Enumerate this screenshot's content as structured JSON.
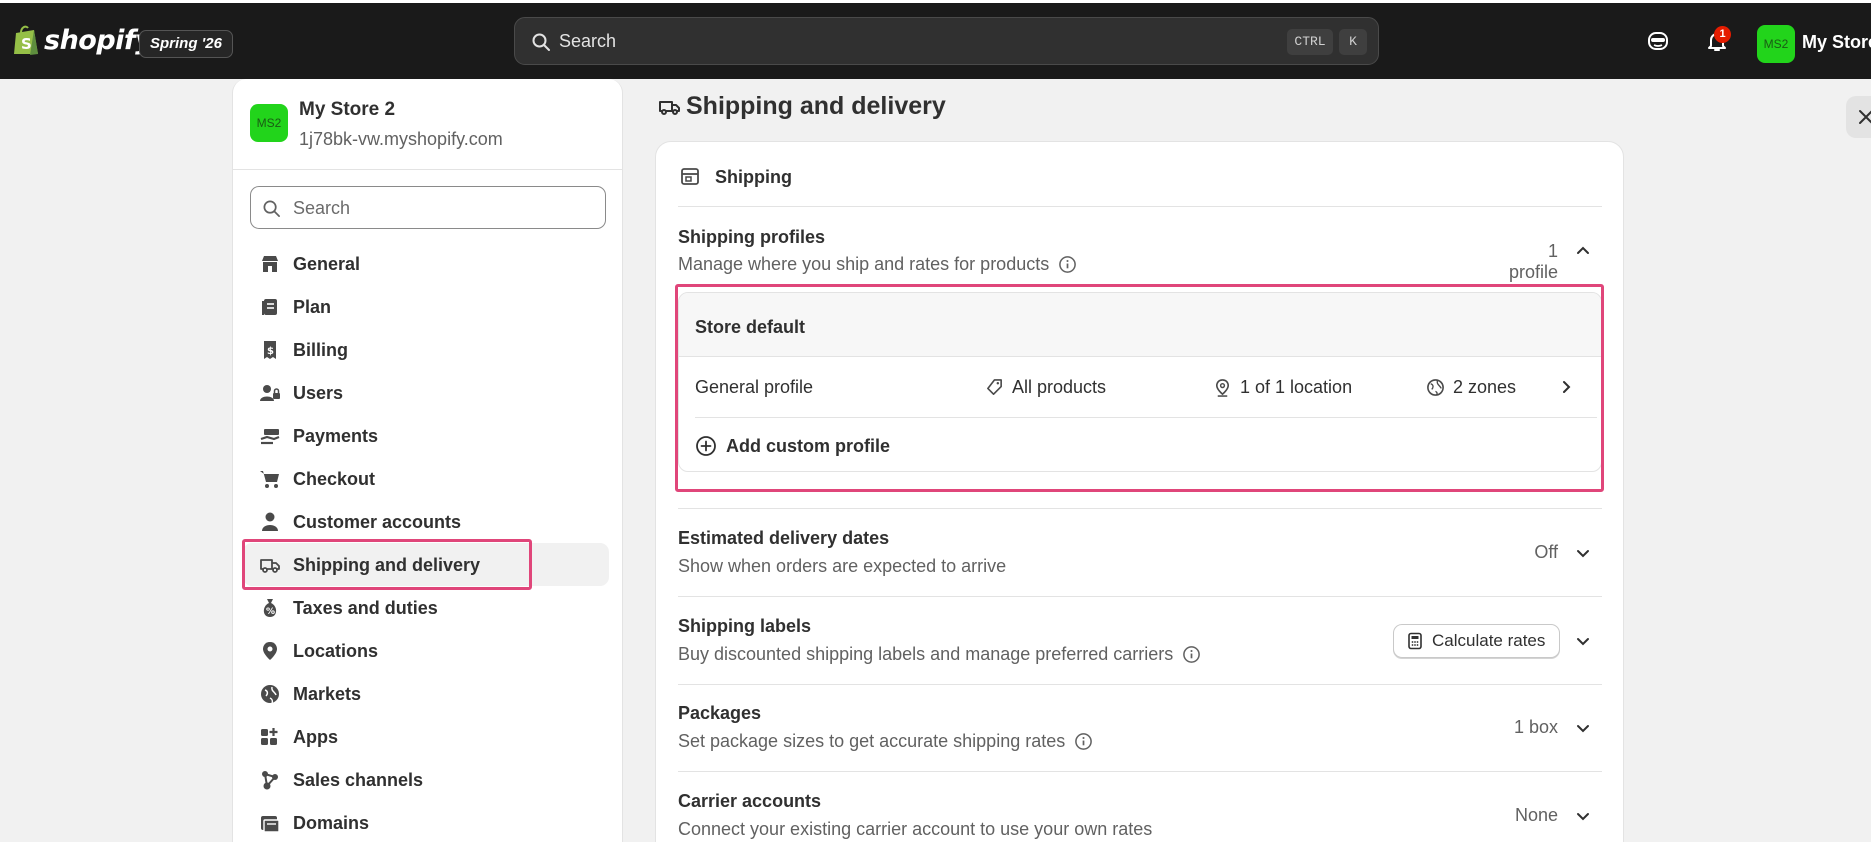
{
  "topbar": {
    "brand": "shopify",
    "edition": "Spring '26",
    "search_placeholder": "Search",
    "shortcut_ctrl": "CTRL",
    "shortcut_k": "K",
    "notification_count": "1",
    "avatar_initials": "MS2",
    "store_name": "My Store"
  },
  "sidebar": {
    "avatar_initials": "MS2",
    "store_name": "My Store 2",
    "store_domain": "1j78bk-vw.myshopify.com",
    "search_placeholder": "Search",
    "items": [
      {
        "label": "General",
        "icon": "store-icon"
      },
      {
        "label": "Plan",
        "icon": "plan-icon"
      },
      {
        "label": "Billing",
        "icon": "billing-icon"
      },
      {
        "label": "Users",
        "icon": "users-icon"
      },
      {
        "label": "Payments",
        "icon": "payments-icon"
      },
      {
        "label": "Checkout",
        "icon": "cart-icon"
      },
      {
        "label": "Customer accounts",
        "icon": "person-icon"
      },
      {
        "label": "Shipping and delivery",
        "icon": "truck-icon",
        "active": true
      },
      {
        "label": "Taxes and duties",
        "icon": "tax-icon"
      },
      {
        "label": "Locations",
        "icon": "location-icon"
      },
      {
        "label": "Markets",
        "icon": "globe-icon"
      },
      {
        "label": "Apps",
        "icon": "apps-icon"
      },
      {
        "label": "Sales channels",
        "icon": "channels-icon"
      },
      {
        "label": "Domains",
        "icon": "domains-icon"
      }
    ]
  },
  "main": {
    "page_title": "Shipping and delivery",
    "card_title": "Shipping",
    "profiles": {
      "title": "Shipping profiles",
      "description": "Manage where you ship and rates for products",
      "count": "1 profile",
      "group_title": "Store default",
      "row": {
        "name": "General profile",
        "products": "All products",
        "locations": "1 of 1 location",
        "zones": "2 zones"
      },
      "add_label": "Add custom profile"
    },
    "delivery_dates": {
      "title": "Estimated delivery dates",
      "description": "Show when orders are expected to arrive",
      "status": "Off"
    },
    "labels": {
      "title": "Shipping labels",
      "description": "Buy discounted shipping labels and manage preferred carriers",
      "button": "Calculate rates"
    },
    "packages": {
      "title": "Packages",
      "description": "Set package sizes to get accurate shipping rates",
      "status": "1 box"
    },
    "carriers": {
      "title": "Carrier accounts",
      "description": "Connect your existing carrier account to use your own rates",
      "status": "None"
    }
  },
  "colors": {
    "topbar": "#1a1a1a",
    "avatar": "#22d41b",
    "highlight": "#e0467a",
    "badge": "#e51c00"
  }
}
